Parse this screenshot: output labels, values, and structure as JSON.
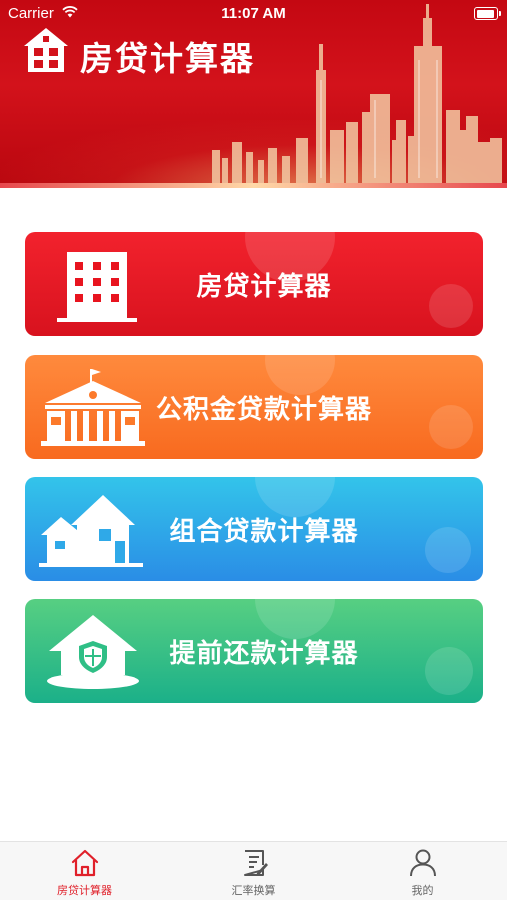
{
  "status_bar": {
    "carrier": "Carrier",
    "time": "11:07 AM"
  },
  "header": {
    "title": "房贷计算器"
  },
  "cards": [
    {
      "label": "房贷计算器",
      "icon": "building-icon",
      "color": "#e8141f"
    },
    {
      "label": "公积金贷款计算器",
      "icon": "institution-building-icon",
      "color": "#fc7a2b"
    },
    {
      "label": "组合贷款计算器",
      "icon": "houses-icon",
      "color": "#2fa9e8"
    },
    {
      "label": "提前还款计算器",
      "icon": "shield-house-icon",
      "color": "#2fbf86"
    }
  ],
  "tabbar": {
    "tabs": [
      {
        "label": "房贷计算器",
        "icon": "home-icon",
        "active": true
      },
      {
        "label": "汇率换算",
        "icon": "document-edit-icon",
        "active": false
      },
      {
        "label": "我的",
        "icon": "user-icon",
        "active": false
      }
    ],
    "active_color": "#e0202a"
  }
}
